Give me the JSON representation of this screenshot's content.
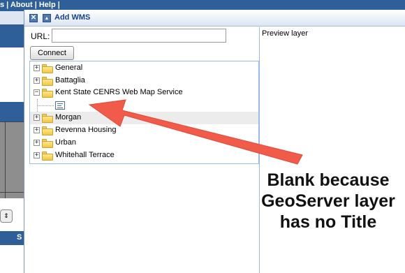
{
  "background": {
    "top_links": "s | About | Help |",
    "bottom_bar_text": "S"
  },
  "dialog": {
    "title": "Add WMS",
    "close_glyph": "✕",
    "collapse_glyph": "▲",
    "url_label": "URL:",
    "url_value": "",
    "connect_label": "Connect",
    "preview_label": "Preview layer"
  },
  "tree": {
    "nodes": [
      {
        "label": "General",
        "expanded": false
      },
      {
        "label": "Battaglia",
        "expanded": false
      },
      {
        "label": "Kent State CENRS Web Map Service",
        "expanded": true,
        "children": [
          {
            "label": ""
          }
        ]
      },
      {
        "label": "Morgan",
        "expanded": false
      },
      {
        "label": "Revenna Housing",
        "expanded": false
      },
      {
        "label": "Urban",
        "expanded": false
      },
      {
        "label": "Whitehall Terrace",
        "expanded": false
      }
    ],
    "plus_glyph": "+",
    "minus_glyph": "−"
  },
  "annotation": {
    "line1": "Blank because",
    "line2": "GeoServer layer",
    "line3": "has no Title",
    "arrow_color": "#f05b4a"
  }
}
